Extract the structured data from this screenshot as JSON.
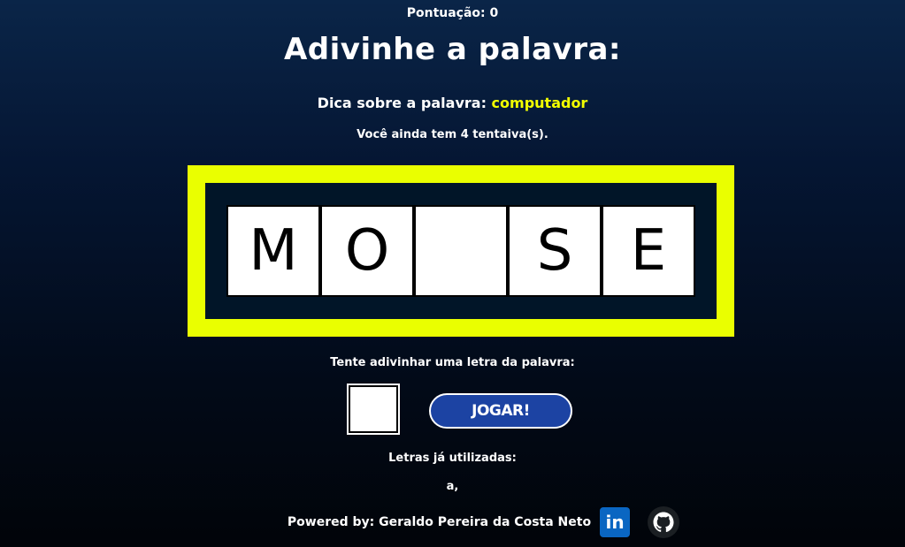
{
  "header": {
    "score_text": "Pontuação: 0",
    "title": "Adivinhe a palavra:",
    "hint_label": "Dica sobre a palavra:",
    "hint_value": "computador",
    "attempts_text": "Você ainda tem 4 tentaiva(s)."
  },
  "board": {
    "tiles": [
      "M",
      "O",
      "",
      "S",
      "E"
    ]
  },
  "guess": {
    "prompt": "Tente adivinhar uma letra da palavra:",
    "input_value": "",
    "play_label": "JOGAR!"
  },
  "used_letters": {
    "title": "Letras já utilizadas:",
    "list": "a,"
  },
  "footer": {
    "powered_by": "Powered by: Geraldo Pereira da Costa Neto",
    "linkedin_text": "in"
  },
  "colors": {
    "accent_yellow": "#eaff00",
    "button_blue": "#1c43a3",
    "linkedin_blue": "#0a66c2"
  },
  "icons": [
    "linkedin-icon",
    "github-icon"
  ]
}
